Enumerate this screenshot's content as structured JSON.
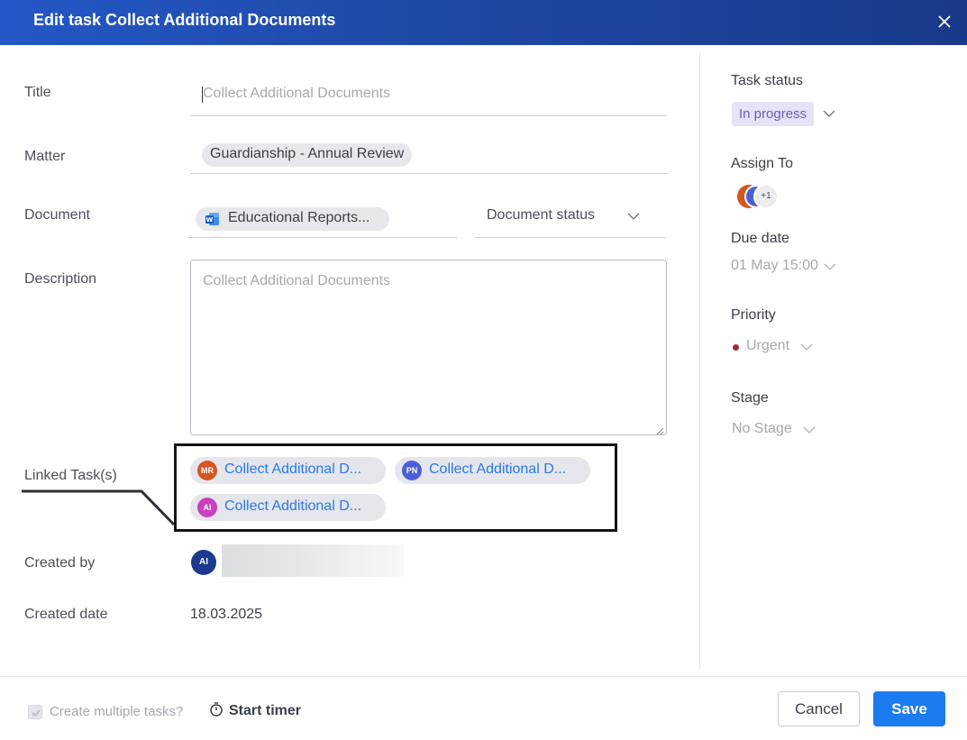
{
  "header": {
    "title": "Edit task Collect Additional Documents",
    "close_icon": "close-icon"
  },
  "form": {
    "title_label": "Title",
    "title_value": "Collect Additional Documents",
    "matter_label": "Matter",
    "matter_value": "Guardianship - Annual Review",
    "document_label": "Document",
    "document_value": "Educational Reports...",
    "document_icon": "word-document-icon",
    "document_status_label": "Document status",
    "description_label": "Description",
    "description_placeholder": "Collect Additional Documents",
    "linked_tasks_label": "Linked Task(s)",
    "linked_tasks": [
      {
        "initials": "MR",
        "color": "#d4561f",
        "label": "Collect Additional D..."
      },
      {
        "initials": "PN",
        "color": "#4a5fd6",
        "label": "Collect Additional D..."
      },
      {
        "initials": "AI",
        "color": "#c93fc0",
        "label": "Collect Additional D..."
      }
    ],
    "created_by_label": "Created by",
    "created_by_initials": "AI",
    "created_date_label": "Created date",
    "created_date_value": "18.03.2025"
  },
  "sidebar": {
    "task_status_label": "Task status",
    "task_status_value": "In progress",
    "status_color": "#6a5fb0",
    "assign_to_label": "Assign To",
    "assign_more": "+1",
    "due_date_label": "Due date",
    "due_date_value": "01 May 15:00",
    "priority_label": "Priority",
    "priority_value": "Urgent",
    "priority_color": "#a12a2a",
    "stage_label": "Stage",
    "stage_value": "No Stage"
  },
  "footer": {
    "create_multiple_label": "Create multiple tasks?",
    "create_multiple_checked": true,
    "start_timer_label": "Start timer",
    "cancel_label": "Cancel",
    "save_label": "Save",
    "accent_color": "#1a7cf0"
  }
}
